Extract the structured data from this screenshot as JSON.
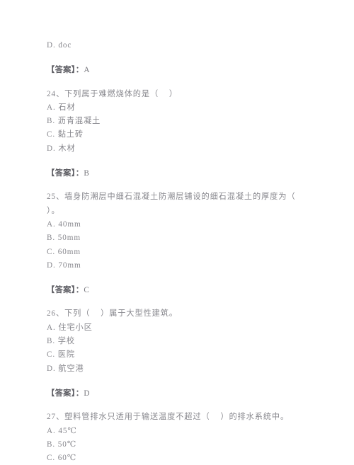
{
  "document": {
    "type": "exam-question-sheet",
    "language": "zh-CN",
    "background_color": "#ffffff",
    "text_color": "#8a8a90",
    "answer_label": "【答案】：",
    "blocks": [
      {
        "kind": "orphan_option",
        "text": "D. doc"
      },
      {
        "kind": "answer",
        "label": "【答案】：",
        "value": "A"
      },
      {
        "kind": "question",
        "number": "24",
        "stem": "24、下列属于难燃烧体的是（    ）",
        "options": [
          "A. 石材",
          "B. 沥青混凝土",
          "C. 黏土砖",
          "D. 木材"
        ]
      },
      {
        "kind": "answer",
        "label": "【答案】：",
        "value": "B"
      },
      {
        "kind": "question",
        "number": "25",
        "stem": "25、墙身防潮层中细石混凝土防潮层铺设的细石混凝土的厚度为（\n）。",
        "options": [
          "A. 40mm",
          "B. 50mm",
          "C. 60mm",
          "D. 70mm"
        ]
      },
      {
        "kind": "answer",
        "label": "【答案】：",
        "value": "C"
      },
      {
        "kind": "question",
        "number": "26",
        "stem": "26、下列（    ）属于大型性建筑。",
        "options": [
          "A. 住宅小区",
          "B. 学校",
          "C. 医院",
          "D. 航空港"
        ]
      },
      {
        "kind": "answer",
        "label": "【答案】：",
        "value": "D"
      },
      {
        "kind": "question",
        "number": "27",
        "stem": "27、塑料管排水只适用于输送温度不超过（    ）的排水系统中。",
        "options": [
          "A. 45℃",
          "B. 50℃",
          "C. 60℃"
        ]
      }
    ]
  }
}
